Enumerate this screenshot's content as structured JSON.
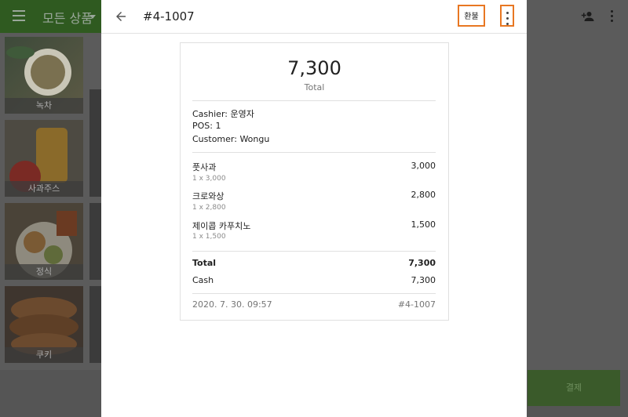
{
  "background": {
    "category_label": "모든 상품",
    "tiles": [
      {
        "label": "녹차"
      },
      {
        "label": "사과주스"
      },
      {
        "label": "정식"
      },
      {
        "label": "쿠키"
      }
    ],
    "pay_button_label": "결제"
  },
  "dialog": {
    "title": "#4-1007",
    "refund_label": "환불"
  },
  "receipt": {
    "total_amount": "7,300",
    "total_caption": "Total",
    "cashier": "Cashier: 운영자",
    "pos": "POS: 1",
    "customer": "Customer: Wongu",
    "items": [
      {
        "name": "풋사과",
        "qty": "1 x 3,000",
        "price": "3,000"
      },
      {
        "name": "크로와상",
        "qty": "1 x 2,800",
        "price": "2,800"
      },
      {
        "name": "제이콥 카푸치노",
        "qty": "1 x 1,500",
        "price": "1,500"
      }
    ],
    "summary": {
      "total_label": "Total",
      "total_value": "7,300",
      "cash_label": "Cash",
      "cash_value": "7,300"
    },
    "date": "2020. 7. 30. 09:57",
    "receipt_number": "#4-1007"
  },
  "colors": {
    "highlight": "#e87722",
    "header_green": "#2f5a20"
  }
}
